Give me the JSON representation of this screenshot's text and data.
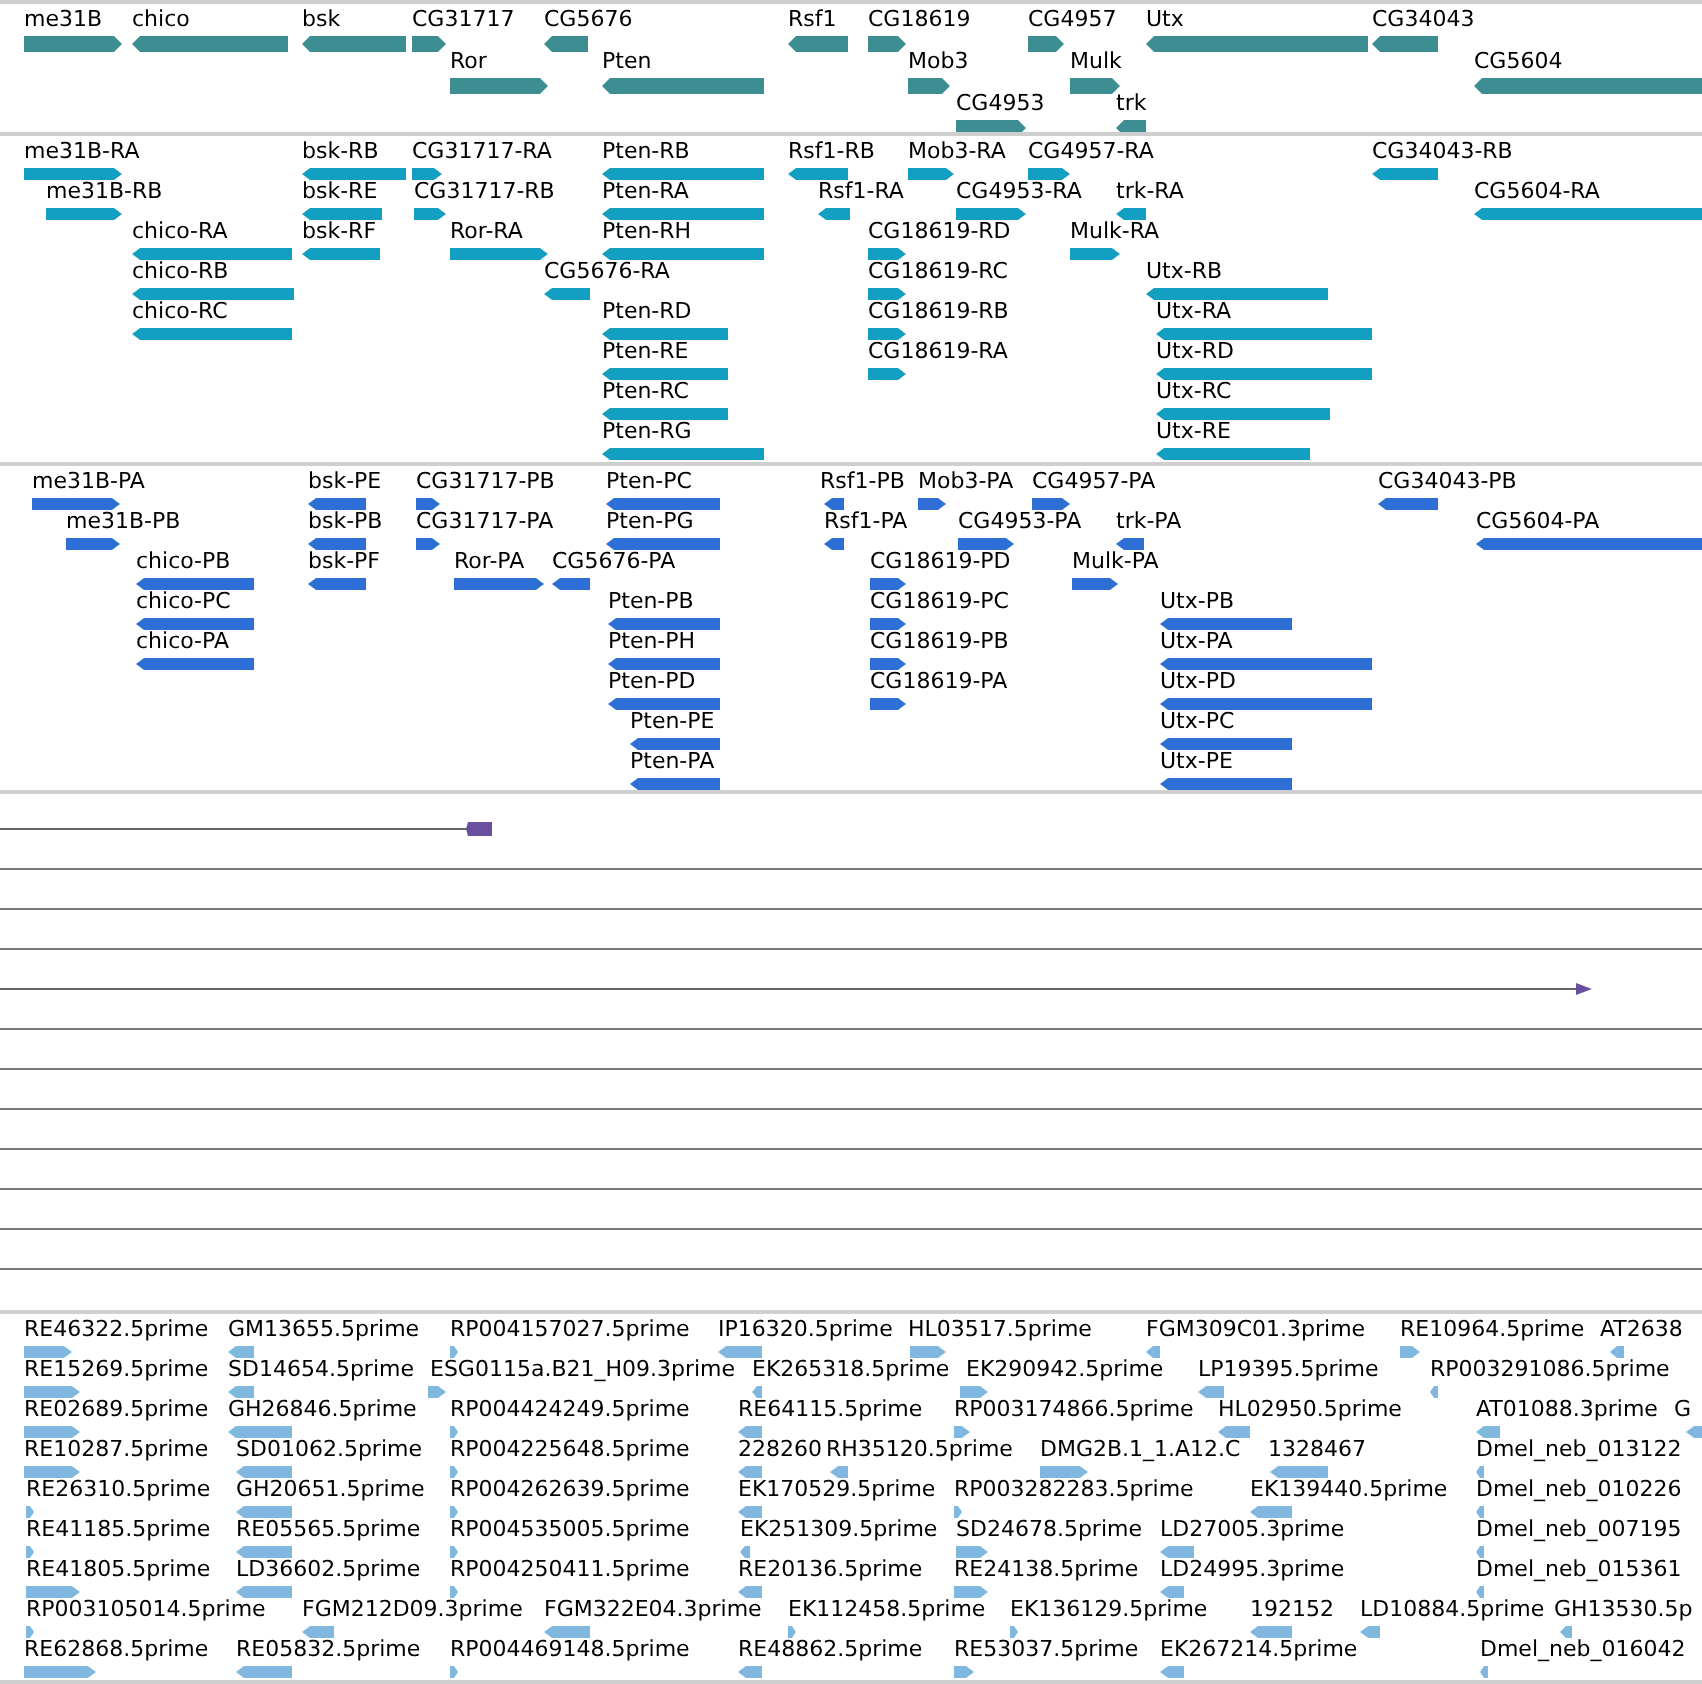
{
  "gene_track": {
    "features": [
      {
        "label": "me31B",
        "reverse": false
      },
      {
        "label": "chico",
        "reverse": true
      },
      {
        "label": "bsk",
        "reverse": true
      },
      {
        "label": "CG31717",
        "reverse": false
      },
      {
        "label": "CG5676",
        "reverse": true
      },
      {
        "label": "Rsf1",
        "reverse": true
      },
      {
        "label": "CG18619",
        "reverse": false
      },
      {
        "label": "CG4957",
        "reverse": false
      },
      {
        "label": "Utx",
        "reverse": true
      },
      {
        "label": "CG34043",
        "reverse": true
      },
      {
        "label": "Ror",
        "reverse": false
      },
      {
        "label": "Pten",
        "reverse": true
      },
      {
        "label": "Mob3",
        "reverse": false
      },
      {
        "label": "Mulk",
        "reverse": false
      },
      {
        "label": "CG5604",
        "reverse": true
      },
      {
        "label": "CG4953",
        "reverse": false
      },
      {
        "label": "trk",
        "reverse": true
      }
    ]
  },
  "transcript_track": {
    "features": [
      {
        "label": "me31B-RA",
        "reverse": false
      },
      {
        "label": "bsk-RB",
        "reverse": true
      },
      {
        "label": "CG31717-RA",
        "reverse": false
      },
      {
        "label": "Pten-RB",
        "reverse": true
      },
      {
        "label": "Rsf1-RB",
        "reverse": true
      },
      {
        "label": "Mob3-RA",
        "reverse": false
      },
      {
        "label": "CG4957-RA",
        "reverse": false
      },
      {
        "label": "CG34043-RB",
        "reverse": true
      },
      {
        "label": "me31B-RB",
        "reverse": false
      },
      {
        "label": "bsk-RE",
        "reverse": true
      },
      {
        "label": "CG31717-RB",
        "reverse": false
      },
      {
        "label": "Pten-RA",
        "reverse": true
      },
      {
        "label": "Rsf1-RA",
        "reverse": true
      },
      {
        "label": "CG4953-RA",
        "reverse": false
      },
      {
        "label": "trk-RA",
        "reverse": true
      },
      {
        "label": "CG5604-RA",
        "reverse": true
      },
      {
        "label": "chico-RA",
        "reverse": true
      },
      {
        "label": "bsk-RF",
        "reverse": true
      },
      {
        "label": "Ror-RA",
        "reverse": false
      },
      {
        "label": "Pten-RH",
        "reverse": true
      },
      {
        "label": "CG18619-RD",
        "reverse": false
      },
      {
        "label": "Mulk-RA",
        "reverse": false
      },
      {
        "label": "chico-RB",
        "reverse": true
      },
      {
        "label": "CG5676-RA",
        "reverse": true
      },
      {
        "label": "CG18619-RC",
        "reverse": false
      },
      {
        "label": "Utx-RB",
        "reverse": true
      },
      {
        "label": "chico-RC",
        "reverse": true
      },
      {
        "label": "Pten-RD",
        "reverse": true
      },
      {
        "label": "CG18619-RB",
        "reverse": false
      },
      {
        "label": "Utx-RA",
        "reverse": true
      },
      {
        "label": "Pten-RE",
        "reverse": true
      },
      {
        "label": "CG18619-RA",
        "reverse": false
      },
      {
        "label": "Utx-RD",
        "reverse": true
      },
      {
        "label": "Pten-RC",
        "reverse": true
      },
      {
        "label": "Utx-RC",
        "reverse": true
      },
      {
        "label": "Pten-RG",
        "reverse": true
      },
      {
        "label": "Utx-RE",
        "reverse": true
      }
    ]
  },
  "protein_track": {
    "features": [
      {
        "label": "me31B-PA",
        "reverse": false
      },
      {
        "label": "bsk-PE",
        "reverse": true
      },
      {
        "label": "CG31717-PB",
        "reverse": false
      },
      {
        "label": "Pten-PC",
        "reverse": true
      },
      {
        "label": "Rsf1-PB",
        "reverse": true
      },
      {
        "label": "Mob3-PA",
        "reverse": false
      },
      {
        "label": "CG4957-PA",
        "reverse": false
      },
      {
        "label": "CG34043-PB",
        "reverse": true
      },
      {
        "label": "me31B-PB",
        "reverse": false
      },
      {
        "label": "bsk-PB",
        "reverse": true
      },
      {
        "label": "CG31717-PA",
        "reverse": false
      },
      {
        "label": "Pten-PG",
        "reverse": true
      },
      {
        "label": "Rsf1-PA",
        "reverse": true
      },
      {
        "label": "CG4953-PA",
        "reverse": false
      },
      {
        "label": "trk-PA",
        "reverse": true
      },
      {
        "label": "CG5604-PA",
        "reverse": true
      },
      {
        "label": "chico-PB",
        "reverse": true
      },
      {
        "label": "bsk-PF",
        "reverse": true
      },
      {
        "label": "Ror-PA",
        "reverse": false
      },
      {
        "label": "CG5676-PA",
        "reverse": true
      },
      {
        "label": "CG18619-PD",
        "reverse": false
      },
      {
        "label": "Mulk-PA",
        "reverse": false
      },
      {
        "label": "chico-PC",
        "reverse": true
      },
      {
        "label": "Pten-PB",
        "reverse": true
      },
      {
        "label": "CG18619-PC",
        "reverse": false
      },
      {
        "label": "Utx-PB",
        "reverse": true
      },
      {
        "label": "chico-PA",
        "reverse": true
      },
      {
        "label": "Pten-PH",
        "reverse": true
      },
      {
        "label": "CG18619-PB",
        "reverse": false
      },
      {
        "label": "Utx-PA",
        "reverse": true
      },
      {
        "label": "Pten-PD",
        "reverse": true
      },
      {
        "label": "CG18619-PA",
        "reverse": false
      },
      {
        "label": "Utx-PD",
        "reverse": true
      },
      {
        "label": "Pten-PE",
        "reverse": true
      },
      {
        "label": "Utx-PC",
        "reverse": true
      },
      {
        "label": "Pten-PA",
        "reverse": true
      },
      {
        "label": "Utx-PE",
        "reverse": true
      }
    ]
  },
  "est_track": {
    "features": [
      {
        "label": "RE46322.5prime",
        "reverse": false
      },
      {
        "label": "GM13655.5prime",
        "reverse": true
      },
      {
        "label": "RP004157027.5prime",
        "reverse": false
      },
      {
        "label": "IP16320.5prime",
        "reverse": true
      },
      {
        "label": "HL03517.5prime",
        "reverse": false
      },
      {
        "label": "FGM309C01.3prime",
        "reverse": true
      },
      {
        "label": "RE10964.5prime",
        "reverse": false
      },
      {
        "label": "AT2638",
        "reverse": true
      },
      {
        "label": "RE15269.5prime",
        "reverse": false
      },
      {
        "label": "SD14654.5prime",
        "reverse": true
      },
      {
        "label": "ESG0115a.B21_H09.3prime",
        "reverse": false
      },
      {
        "label": "EK265318.5prime",
        "reverse": true
      },
      {
        "label": "EK290942.5prime",
        "reverse": false
      },
      {
        "label": "LP19395.5prime",
        "reverse": true
      },
      {
        "label": "RP003291086.5prime",
        "reverse": true
      },
      {
        "label": "RE02689.5prime",
        "reverse": false
      },
      {
        "label": "GH26846.5prime",
        "reverse": true
      },
      {
        "label": "RP004424249.5prime",
        "reverse": false
      },
      {
        "label": "RE64115.5prime",
        "reverse": true
      },
      {
        "label": "RP003174866.5prime",
        "reverse": false
      },
      {
        "label": "HL02950.5prime",
        "reverse": true
      },
      {
        "label": "AT01088.3prime",
        "reverse": true
      },
      {
        "label": "G",
        "reverse": true
      },
      {
        "label": "RE10287.5prime",
        "reverse": false
      },
      {
        "label": "SD01062.5prime",
        "reverse": true
      },
      {
        "label": "RP004225648.5prime",
        "reverse": false
      },
      {
        "label": "228260",
        "reverse": true
      },
      {
        "label": "RH35120.5prime",
        "reverse": true
      },
      {
        "label": "DMG2B.1_1.A12.C",
        "reverse": false
      },
      {
        "label": "1328467",
        "reverse": true
      },
      {
        "label": "Dmel_neb_013122",
        "reverse": true
      },
      {
        "label": "RE26310.5prime",
        "reverse": false
      },
      {
        "label": "GH20651.5prime",
        "reverse": true
      },
      {
        "label": "RP004262639.5prime",
        "reverse": false
      },
      {
        "label": "EK170529.5prime",
        "reverse": true
      },
      {
        "label": "RP003282283.5prime",
        "reverse": false
      },
      {
        "label": "EK139440.5prime",
        "reverse": true
      },
      {
        "label": "Dmel_neb_010226",
        "reverse": true
      },
      {
        "label": "RE41185.5prime",
        "reverse": false
      },
      {
        "label": "RE05565.5prime",
        "reverse": true
      },
      {
        "label": "RP004535005.5prime",
        "reverse": false
      },
      {
        "label": "EK251309.5prime",
        "reverse": true
      },
      {
        "label": "SD24678.5prime",
        "reverse": false
      },
      {
        "label": "LD27005.3prime",
        "reverse": true
      },
      {
        "label": "Dmel_neb_007195",
        "reverse": true
      },
      {
        "label": "RE41805.5prime",
        "reverse": false
      },
      {
        "label": "LD36602.5prime",
        "reverse": true
      },
      {
        "label": "RP004250411.5prime",
        "reverse": false
      },
      {
        "label": "RE20136.5prime",
        "reverse": true
      },
      {
        "label": "RE24138.5prime",
        "reverse": false
      },
      {
        "label": "LD24995.3prime",
        "reverse": true
      },
      {
        "label": "Dmel_neb_015361",
        "reverse": true
      },
      {
        "label": "RP003105014.5prime",
        "reverse": false
      },
      {
        "label": "FGM212D09.3prime",
        "reverse": true
      },
      {
        "label": "FGM322E04.3prime",
        "reverse": true
      },
      {
        "label": "EK112458.5prime",
        "reverse": false
      },
      {
        "label": "EK136129.5prime",
        "reverse": false
      },
      {
        "label": "192152",
        "reverse": true
      },
      {
        "label": "LD10884.5prime",
        "reverse": true
      },
      {
        "label": "GH13530.5p",
        "reverse": true
      },
      {
        "label": "RE62868.5prime",
        "reverse": false
      },
      {
        "label": "RE05832.5prime",
        "reverse": true
      },
      {
        "label": "RP004469148.5prime",
        "reverse": false
      },
      {
        "label": "RE48862.5prime",
        "reverse": true
      },
      {
        "label": "RE53037.5prime",
        "reverse": false
      },
      {
        "label": "EK267214.5prime",
        "reverse": true
      },
      {
        "label": "Dmel_neb_016042",
        "reverse": true
      }
    ]
  }
}
